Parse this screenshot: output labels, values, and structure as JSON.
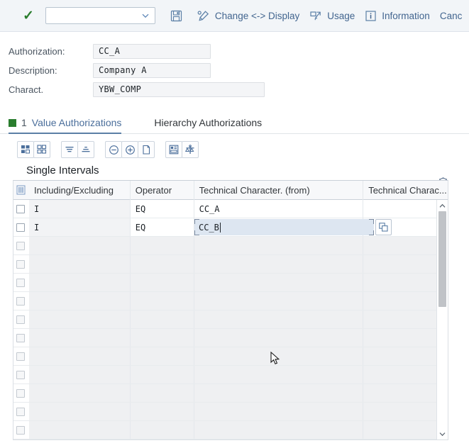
{
  "toolbar": {
    "confirm_icon": "check-icon",
    "select_value": "",
    "select_placeholder": "",
    "buttons": [
      {
        "label": "",
        "icon": "save-icon",
        "name": "save-button"
      },
      {
        "label": "Change <-> Display",
        "icon": "edit-pencil-icon",
        "name": "change-display-button"
      },
      {
        "label": "Usage",
        "icon": "usage-arrow-icon",
        "name": "usage-button"
      },
      {
        "label": "Information",
        "icon": "information-icon",
        "name": "information-button"
      },
      {
        "label": "Canc",
        "icon": "",
        "name": "cancel-button"
      }
    ]
  },
  "form": {
    "fields": [
      {
        "label": "Authorization:",
        "value": "CC_A"
      },
      {
        "label": "Description:",
        "value": "Company  A"
      },
      {
        "label": "Charact.",
        "value": "YBW_COMP"
      }
    ]
  },
  "tabs": {
    "active": {
      "marker_color": "#2a7d2e",
      "count": "1",
      "label": "Value Authorizations"
    },
    "inactive": {
      "label": "Hierarchy Authorizations"
    }
  },
  "table_toolbar": {
    "buttons": [
      {
        "name": "expand-all-button",
        "icon": "grid-blocks-icon"
      },
      {
        "name": "collapse-all-button",
        "icon": "grid-outline-icon"
      },
      {
        "name": "sort-descending-button",
        "icon": "sort-descending-icon"
      },
      {
        "name": "sort-ascending-button",
        "icon": "sort-ascending-icon"
      },
      {
        "name": "delete-row-button",
        "icon": "minus-circle-icon"
      },
      {
        "name": "insert-row-button",
        "icon": "plus-circle-icon"
      },
      {
        "name": "copy-row-button",
        "icon": "page-copy-icon"
      },
      {
        "name": "layout-button",
        "icon": "layout-grid-icon"
      },
      {
        "name": "tools-button",
        "icon": "wrench-icon"
      }
    ],
    "settings_icon": "gear-icon"
  },
  "section": {
    "title": "Single Intervals"
  },
  "table": {
    "columns": [
      {
        "key": "select",
        "label": ""
      },
      {
        "key": "incl_excl",
        "label": "Including/Excluding"
      },
      {
        "key": "operator",
        "label": "Operator"
      },
      {
        "key": "tech_from",
        "label": "Technical Character. (from)"
      },
      {
        "key": "tech_to",
        "label": "Technical Charac..."
      }
    ],
    "header_icon": "column-settings-icon",
    "rows": [
      {
        "incl_excl": "I",
        "operator": "EQ",
        "tech_from": "CC_A",
        "tech_to": "",
        "filled": true,
        "editing": false
      },
      {
        "incl_excl": "I",
        "operator": "EQ",
        "tech_from": "CC_B",
        "tech_to": "",
        "filled": true,
        "editing": true
      }
    ],
    "empty_row_count": 11,
    "editing_cell": {
      "value": "CC_B",
      "value_help_icon": "value-help-icon"
    },
    "scrollbar": {
      "up_icon": "chevron-up-icon",
      "down_icon": "chevron-down-icon"
    }
  },
  "cursor": {
    "icon": "mouse-pointer-icon"
  }
}
